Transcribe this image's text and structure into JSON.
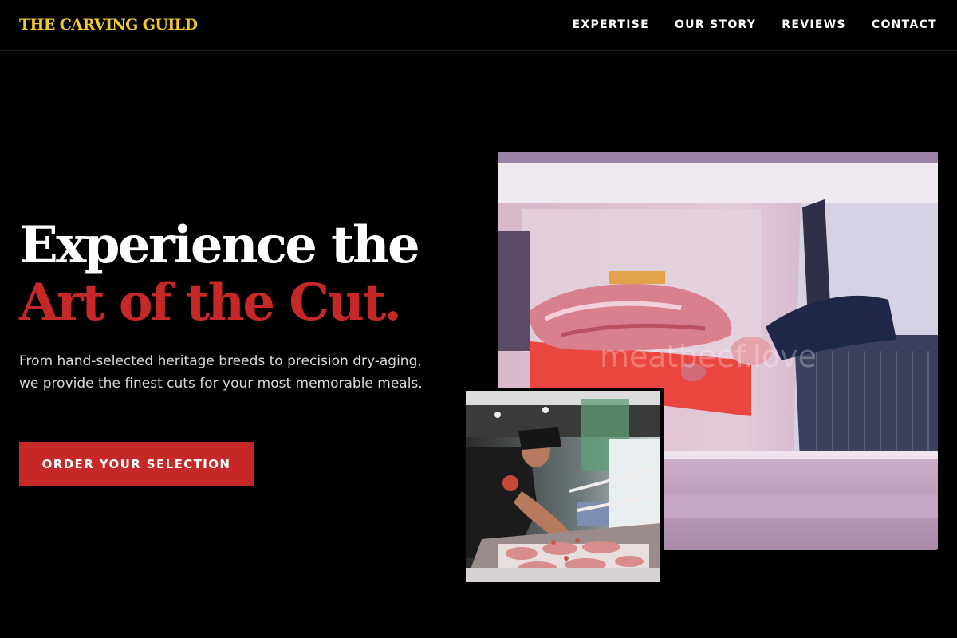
{
  "nav": {
    "logo": "THE CARVING GUILD",
    "links": [
      "EXPERTISE",
      "OUR STORY",
      "REVIEWS",
      "CONTACT"
    ]
  },
  "hero": {
    "title_line1": "Experience the",
    "title_line2": "Art of the Cut.",
    "description": "From hand-selected heritage breeds to precision dry-aging, we provide the finest cuts for your most memorable meals.",
    "cta_label": "ORDER YOUR SELECTION"
  },
  "images": {
    "main_watermark": "meatbeef.love"
  },
  "colors": {
    "background": "#000000",
    "logo": "#f2c82d",
    "accent": "#c62828",
    "text": "#ffffff"
  }
}
